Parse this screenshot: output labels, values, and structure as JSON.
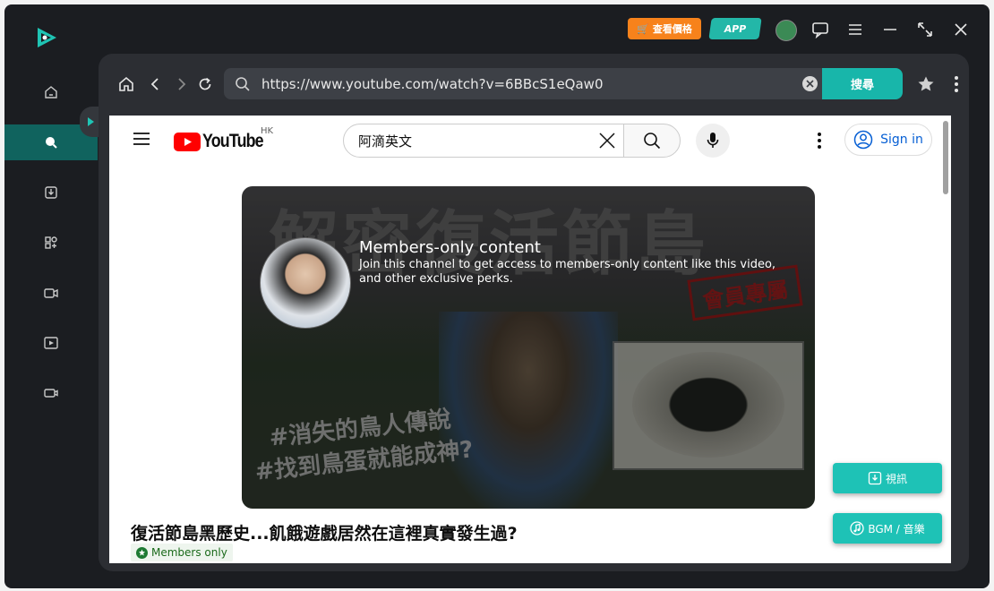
{
  "titlebar": {
    "price_label": "查看價格",
    "app_label": "APP"
  },
  "browser": {
    "url": "https://www.youtube.com/watch?v=6BBcS1eQaw0",
    "search_label": "搜尋"
  },
  "youtube": {
    "region": "HK",
    "search_query": "阿滴英文",
    "sign_in": "Sign in",
    "thumbnail_title": "解密復活節島",
    "thumbnail_stamp": "會員專屬",
    "thumbnail_tag1": "#消失的鳥人傳說",
    "thumbnail_tag2": "#找到鳥蛋就能成神?",
    "members_title": "Members-only content",
    "members_desc": "Join this channel to get access to members-only content like this video, and other exclusive perks.",
    "video_title": "復活節島黑歷史...飢餓遊戲居然在這裡真實發生過?",
    "members_badge": "Members only"
  },
  "download": {
    "video_label": "視訊",
    "audio_label": "BGM / 音樂"
  },
  "colors": {
    "accent": "#18b6aa",
    "promo": "#f7821b",
    "youtube_red": "#ff0000"
  }
}
